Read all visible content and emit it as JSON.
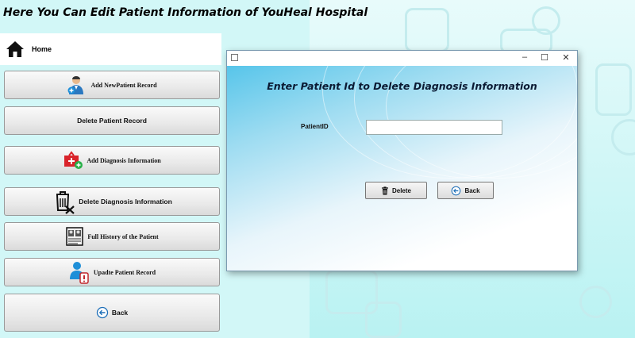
{
  "page": {
    "title": "Here You Can Edit Patient Information of YouHeal Hospital"
  },
  "sidebar": {
    "home": {
      "label": "Home",
      "icon": "home-icon"
    },
    "items": [
      {
        "label": "Add NewPatient Record",
        "icon": "doctor-add-icon"
      },
      {
        "label": "Delete Patient Record",
        "icon": ""
      },
      {
        "label": "Add Diagnosis Information",
        "icon": "medical-add-icon"
      },
      {
        "label": "Delete Diagnosis Information",
        "icon": "trash-x-icon"
      },
      {
        "label": "Full History of the Patient",
        "icon": "id-card-icon"
      },
      {
        "label": "Upadte Patient Record",
        "icon": "user-edit-icon"
      },
      {
        "label": "Back",
        "icon": "back-arrow-icon"
      }
    ]
  },
  "dialog": {
    "window_controls": {
      "minimize": "–",
      "maximize": "☐",
      "close": "✕"
    },
    "heading": "Enter Patient Id to Delete Diagnosis Information",
    "field_label": "PatientID",
    "field_value": "",
    "buttons": {
      "delete": "Delete",
      "back": "Back"
    }
  },
  "colors": {
    "accent": "#2196f3",
    "dialog_gradient_start": "#57c5ea",
    "background": "#d2f7f7"
  }
}
